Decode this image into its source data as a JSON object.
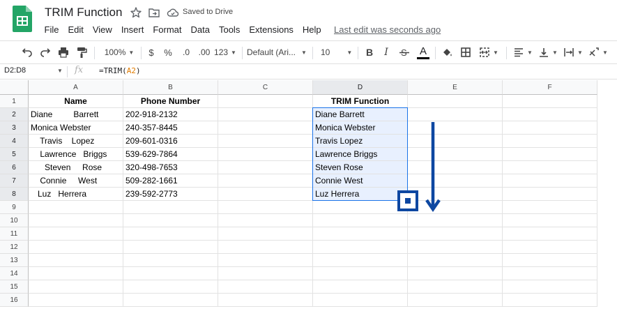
{
  "app": {
    "title": "TRIM Function",
    "saved_status": "Saved to Drive",
    "last_edit": "Last edit was seconds ago",
    "menu": [
      "File",
      "Edit",
      "View",
      "Insert",
      "Format",
      "Data",
      "Tools",
      "Extensions",
      "Help"
    ]
  },
  "toolbar": {
    "zoom": "100%",
    "currency": "$",
    "percent": "%",
    "decrease_decimal": ".0",
    "increase_decimal": ".00",
    "more_formats": "123",
    "font_family": "Default (Ari...",
    "font_size": "10",
    "bold": "B",
    "italic": "I",
    "text_color": "A"
  },
  "formula_bar": {
    "name_box": "D2:D8",
    "fx": "fx",
    "formula_prefix": "=TRIM(",
    "formula_ref": "A2",
    "formula_suffix": ")"
  },
  "sheet": {
    "columns": [
      "A",
      "B",
      "C",
      "D",
      "E",
      "F"
    ],
    "rows": [
      "1",
      "2",
      "3",
      "4",
      "5",
      "6",
      "7",
      "8",
      "9",
      "10",
      "11",
      "12",
      "13",
      "14",
      "15",
      "16"
    ],
    "headers": {
      "A": "Name",
      "B": "Phone Number",
      "D": "TRIM Function"
    },
    "names": [
      "Diane         Barrett",
      "Monica Webster",
      "    Travis    Lopez",
      "    Lawrence   Briggs",
      "      Steven     Rose",
      "    Connie     West",
      "   Luz   Herrera"
    ],
    "phones": [
      "202-918-2132",
      "240-357-8445",
      "209-601-0316",
      "539-629-7864",
      "320-498-7653",
      "509-282-1661",
      "239-592-2773"
    ],
    "trimmed": [
      "Diane Barrett",
      "Monica Webster",
      "Travis Lopez",
      "Lawrence Briggs",
      "Steven Rose",
      "Connie West",
      "Luz Herrera"
    ]
  },
  "colors": {
    "selection": "#1a73e8",
    "selection_fill": "#e8f0fe",
    "annotation": "#0d47a1",
    "logo_green": "#23a566"
  }
}
